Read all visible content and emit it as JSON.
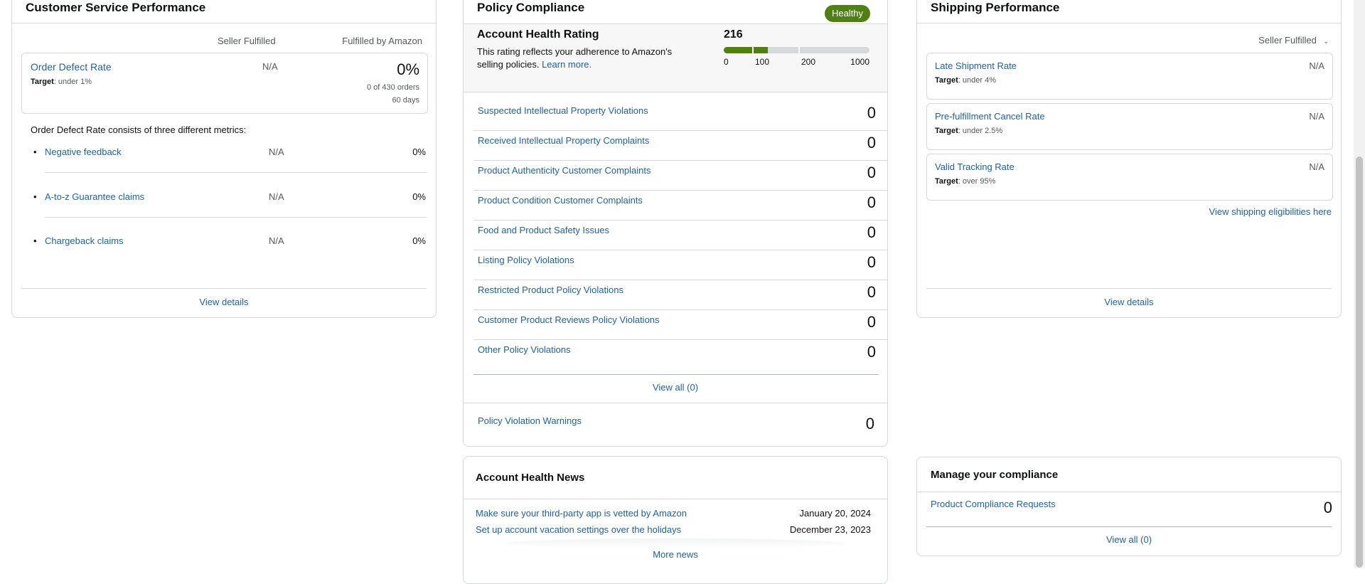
{
  "customer_service": {
    "title": "Customer Service Performance",
    "col_seller": "Seller Fulfilled",
    "col_fba": "Fulfilled by Amazon",
    "odr": {
      "label": "Order Defect Rate",
      "target_label": "Target",
      "target_value": ": under 1%",
      "seller_value": "N/A",
      "fba_value": "0%",
      "orders": "0 of 430 orders",
      "days": "60 days"
    },
    "intro": "Order Defect Rate consists of three different metrics:",
    "metrics": [
      {
        "label": "Negative feedback",
        "seller": "N/A",
        "fba": "0%"
      },
      {
        "label": "A-to-z Guarantee claims",
        "seller": "N/A",
        "fba": "0%"
      },
      {
        "label": "Chargeback claims",
        "seller": "N/A",
        "fba": "0%"
      }
    ],
    "view_details": "View details"
  },
  "policy": {
    "title": "Policy Compliance",
    "badge": "Healthy",
    "ahr_title": "Account Health Rating",
    "ahr_desc": "This rating reflects your adherence to Amazon's selling policies.",
    "ahr_learn": "Learn more.",
    "ahr_value": "216",
    "ahr_fill": 0.3,
    "scale": [
      "0",
      "100",
      "200",
      "1000"
    ],
    "colors": {
      "green": "#508014",
      "track": "#d5d9d9"
    },
    "violations": [
      {
        "label": "Suspected Intellectual Property Violations",
        "count": "0"
      },
      {
        "label": "Received Intellectual Property Complaints",
        "count": "0"
      },
      {
        "label": "Product Authenticity Customer Complaints",
        "count": "0"
      },
      {
        "label": "Product Condition Customer Complaints",
        "count": "0"
      },
      {
        "label": "Food and Product Safety Issues",
        "count": "0"
      },
      {
        "label": "Listing Policy Violations",
        "count": "0"
      },
      {
        "label": "Restricted Product Policy Violations",
        "count": "0"
      },
      {
        "label": "Customer Product Reviews Policy Violations",
        "count": "0"
      },
      {
        "label": "Other Policy Violations",
        "count": "0"
      }
    ],
    "view_all": "View all (0)",
    "warnings_label": "Policy Violation Warnings",
    "warnings_count": "0"
  },
  "shipping": {
    "title": "Shipping Performance",
    "filter": "Seller Fulfilled",
    "metrics": [
      {
        "label": "Late Shipment Rate",
        "target_label": "Target",
        "target_value": ": under 4%",
        "value": "N/A"
      },
      {
        "label": "Pre-fulfillment Cancel Rate",
        "target_label": "Target",
        "target_value": ": under 2.5%",
        "value": "N/A"
      },
      {
        "label": "Valid Tracking Rate",
        "target_label": "Target",
        "target_value": ": over 95%",
        "value": "N/A"
      }
    ],
    "eligibility_link": "View shipping eligibilities here",
    "view_details": "View details"
  },
  "news": {
    "title": "Account Health News",
    "items": [
      {
        "label": "Make sure your third-party app is vetted by Amazon",
        "date": "January 20, 2024"
      },
      {
        "label": "Set up account vacation settings over the holidays",
        "date": "December 23, 2023"
      }
    ],
    "more": "More news"
  },
  "manage": {
    "title": "Manage your compliance",
    "item_label": "Product Compliance Requests",
    "item_count": "0",
    "view_all": "View all (0)"
  }
}
